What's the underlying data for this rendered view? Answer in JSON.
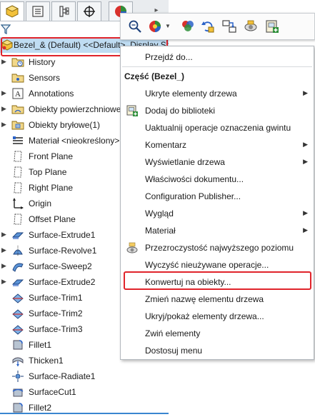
{
  "tabs": [
    {
      "name": "feature-manager",
      "icon": "part-icon",
      "active": true
    },
    {
      "name": "property-manager",
      "icon": "property-list-icon"
    },
    {
      "name": "configuration-manager",
      "icon": "configuration-icon"
    },
    {
      "name": "dimxpert-manager",
      "icon": "crosshair-icon"
    },
    {
      "name": "display-manager",
      "icon": "appearance-pie-icon"
    }
  ],
  "tree": {
    "root_label": "Bezel_& (Default) <<Default>_Display St",
    "items": [
      {
        "label": "History",
        "icon": "history-folder-icon",
        "expandable": true
      },
      {
        "label": "Sensors",
        "icon": "sensors-folder-icon",
        "expandable": false
      },
      {
        "label": "Annotations",
        "icon": "annotations-icon",
        "expandable": true
      },
      {
        "label": "Obiekty powierzchniowe",
        "icon": "surface-bodies-folder-icon",
        "expandable": true
      },
      {
        "label": "Obiekty bryłowe(1)",
        "icon": "solid-bodies-folder-icon",
        "expandable": true
      },
      {
        "label": "Materiał <nieokreślony>",
        "icon": "material-icon",
        "expandable": false
      },
      {
        "label": "Front Plane",
        "icon": "plane-icon",
        "expandable": false
      },
      {
        "label": "Top Plane",
        "icon": "plane-icon",
        "expandable": false
      },
      {
        "label": "Right Plane",
        "icon": "plane-icon",
        "expandable": false
      },
      {
        "label": "Origin",
        "icon": "origin-icon",
        "expandable": false
      },
      {
        "label": "Offset Plane",
        "icon": "plane-icon",
        "expandable": false
      },
      {
        "label": "Surface-Extrude1",
        "icon": "surface-extrude-icon",
        "expandable": true
      },
      {
        "label": "Surface-Revolve1",
        "icon": "surface-revolve-icon",
        "expandable": true
      },
      {
        "label": "Surface-Sweep2",
        "icon": "surface-sweep-icon",
        "expandable": true
      },
      {
        "label": "Surface-Extrude2",
        "icon": "surface-extrude-icon",
        "expandable": true
      },
      {
        "label": "Surface-Trim1",
        "icon": "surface-trim-icon",
        "expandable": false
      },
      {
        "label": "Surface-Trim2",
        "icon": "surface-trim-icon",
        "expandable": false
      },
      {
        "label": "Surface-Trim3",
        "icon": "surface-trim-icon",
        "expandable": false
      },
      {
        "label": "Fillet1",
        "icon": "fillet-icon",
        "expandable": false
      },
      {
        "label": "Thicken1",
        "icon": "thicken-icon",
        "expandable": false
      },
      {
        "label": "Surface-Radiate1",
        "icon": "surface-radiate-icon",
        "expandable": false
      },
      {
        "label": "SurfaceCut1",
        "icon": "surface-cut-icon",
        "expandable": false
      },
      {
        "label": "Fillet2",
        "icon": "fillet-icon",
        "expandable": false
      }
    ]
  },
  "toolbar": {
    "buttons": [
      {
        "name": "zoom-to-selection-icon"
      },
      {
        "name": "appearance-icon",
        "dropdown": true
      },
      {
        "name": "edit-color-icon"
      },
      {
        "name": "rollback-icon"
      },
      {
        "name": "suppress-icon"
      },
      {
        "name": "hide-show-icon"
      },
      {
        "name": "add-to-library-icon"
      }
    ]
  },
  "context_menu": {
    "items": [
      {
        "label": "Przejdź do...",
        "type": "item"
      },
      {
        "type": "separator"
      },
      {
        "label": "Część (Bezel_)",
        "type": "header"
      },
      {
        "label": "Ukryte elementy drzewa",
        "type": "item",
        "submenu": true
      },
      {
        "label": "Dodaj do biblioteki",
        "type": "item",
        "icon": "add-to-library-icon"
      },
      {
        "label": "Uaktualnij operacje oznaczenia gwintu",
        "type": "item"
      },
      {
        "label": "Komentarz",
        "type": "item",
        "submenu": true
      },
      {
        "label": "Wyświetlanie drzewa",
        "type": "item",
        "submenu": true
      },
      {
        "label": "Właściwości dokumentu...",
        "type": "item"
      },
      {
        "label": "Configuration Publisher...",
        "type": "item"
      },
      {
        "label": "Wygląd",
        "type": "item",
        "submenu": true
      },
      {
        "label": "Materiał",
        "type": "item",
        "submenu": true
      },
      {
        "label": "Przezroczystość najwyższego poziomu",
        "type": "item",
        "icon": "transparency-icon"
      },
      {
        "label": "Wyczyść nieużywane operacje...",
        "type": "item"
      },
      {
        "label": "Konwertuj na obiekty...",
        "type": "item",
        "highlighted": true
      },
      {
        "label": "Zmień nazwę elementu drzewa",
        "type": "item"
      },
      {
        "label": "Ukryj/pokaż elementy drzewa...",
        "type": "item"
      },
      {
        "label": "Zwiń elementy",
        "type": "item"
      },
      {
        "label": "Dostosuj menu",
        "type": "item"
      }
    ]
  },
  "colors": {
    "highlight_outline": "#e0242b",
    "selection_blue": "#bfdcf2",
    "accent_blue": "#3a86d0"
  }
}
